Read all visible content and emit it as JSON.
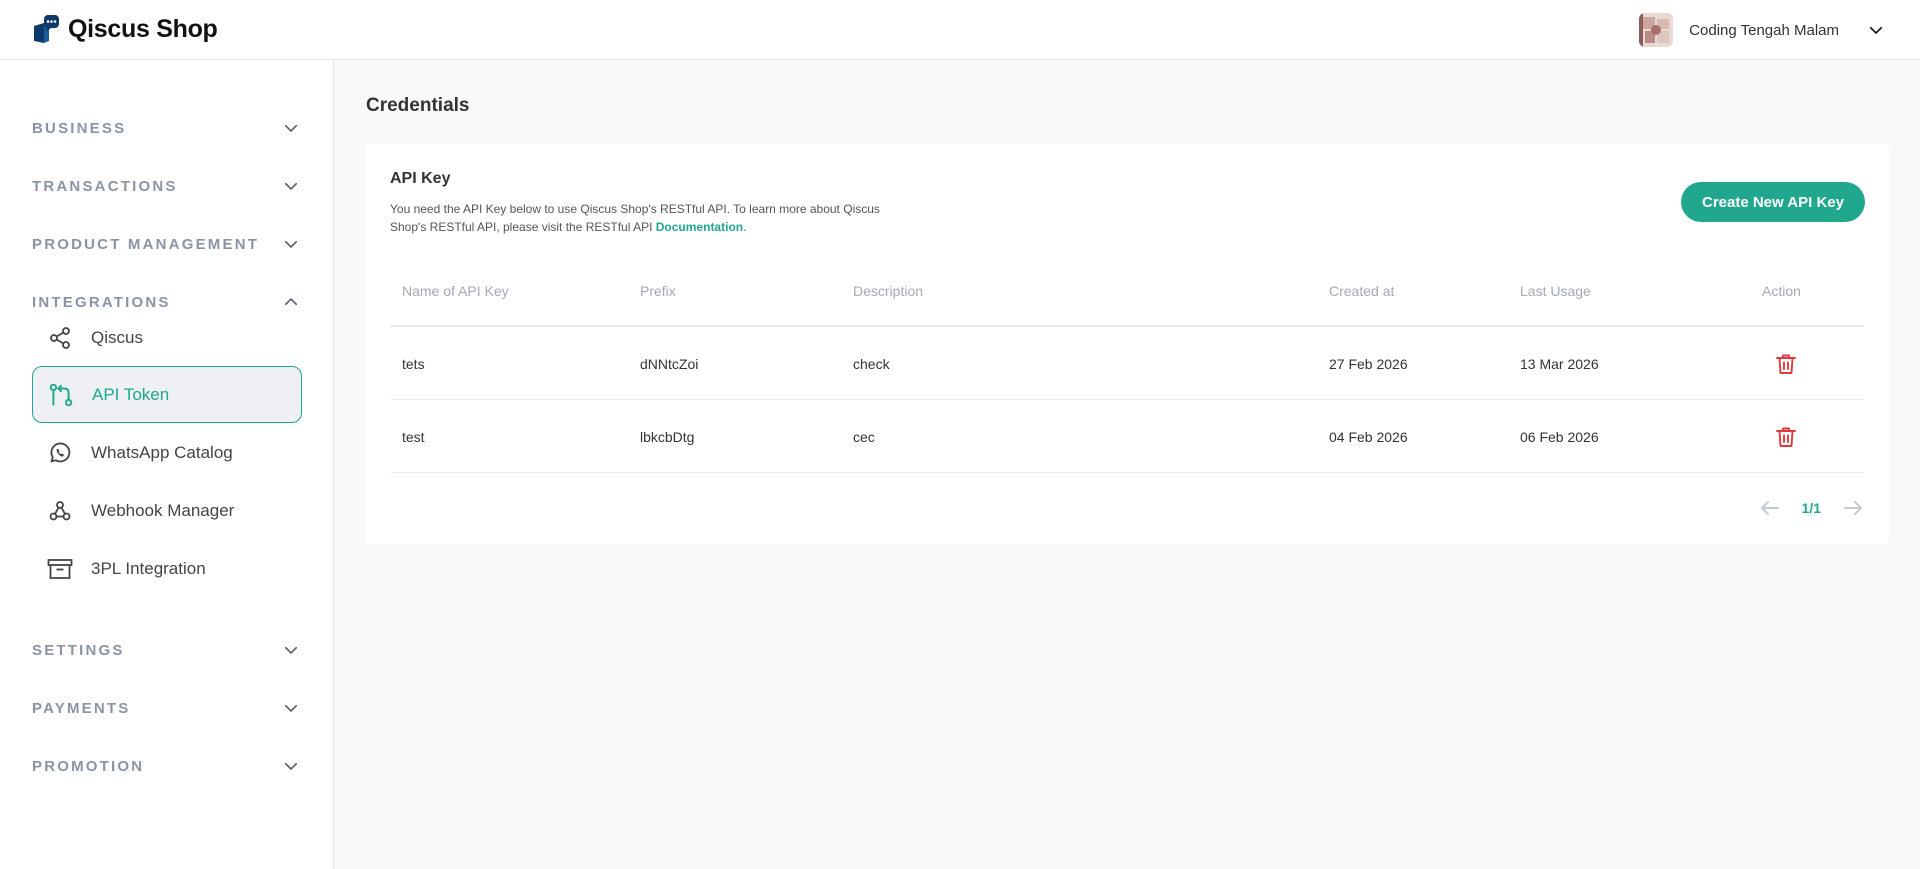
{
  "header": {
    "brand": "Qiscus Shop",
    "user_name": "Coding Tengah Malam"
  },
  "sidebar": {
    "sections": [
      {
        "label": "BUSINESS",
        "expanded": false
      },
      {
        "label": "TRANSACTIONS",
        "expanded": false
      },
      {
        "label": "PRODUCT MANAGEMENT",
        "expanded": false
      },
      {
        "label": "INTEGRATIONS",
        "expanded": true
      },
      {
        "label": "SETTINGS",
        "expanded": false
      },
      {
        "label": "PAYMENTS",
        "expanded": false
      },
      {
        "label": "PROMOTION",
        "expanded": false
      }
    ],
    "integration_items": [
      {
        "label": "Qiscus",
        "icon": "share-icon"
      },
      {
        "label": "API Token",
        "icon": "git-branch-icon",
        "active": true
      },
      {
        "label": "WhatsApp Catalog",
        "icon": "whatsapp-icon"
      },
      {
        "label": "Webhook Manager",
        "icon": "webhook-icon"
      },
      {
        "label": "3PL Integration",
        "icon": "archive-box-icon"
      }
    ]
  },
  "main": {
    "page_title": "Credentials",
    "card": {
      "title": "API Key",
      "description": "You need the API Key below to use Qiscus Shop's RESTful API. To learn more about Qiscus Shop's RESTful API, please visit the RESTful API",
      "link_text": "Documentation",
      "link_suffix": ".",
      "create_button": "Create New API Key"
    },
    "table": {
      "columns": [
        "Name of API Key",
        "Prefix",
        "Description",
        "Created at",
        "Last Usage",
        "Action"
      ],
      "rows": [
        {
          "name": "tets",
          "prefix": "dNNtcZoi",
          "description": "check",
          "created_at": "27 Feb 2026",
          "last_usage": "13 Mar 2026"
        },
        {
          "name": "test",
          "prefix": "lbkcbDtg",
          "description": "cec",
          "created_at": "04 Feb 2026",
          "last_usage": "06 Feb 2026"
        }
      ]
    },
    "pagination": {
      "label": "1/1"
    }
  },
  "colors": {
    "accent": "#20a78d",
    "danger": "#e03b3b",
    "section_label": "#8a94a3",
    "brand_dark": "#0d3a6b"
  }
}
